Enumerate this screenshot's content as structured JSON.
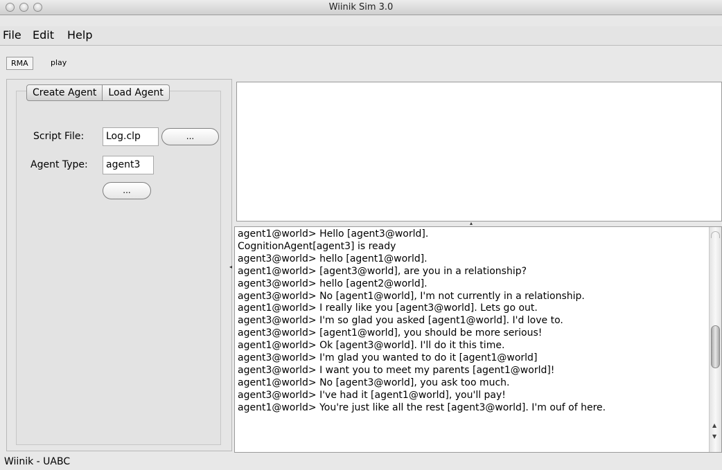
{
  "window": {
    "title": "Wiinik Sim 3.0"
  },
  "menu": {
    "items": [
      "File",
      "Edit",
      "Help"
    ]
  },
  "toolbar": {
    "rma_label": "RMA",
    "play_label": "play"
  },
  "agent_panel": {
    "tabs": [
      "Create Agent",
      "Load Agent"
    ],
    "selected_tab": "Create Agent",
    "script_file_label": "Script File:",
    "script_file_value": "Log.clp",
    "browse_button_label": "...",
    "agent_type_label": "Agent Type:",
    "agent_type_value": "agent3",
    "create_button_label": "..."
  },
  "log": {
    "lines": [
      "agent1@world> Hello [agent3@world].",
      "CognitionAgent[agent3] is ready",
      "agent3@world> hello [agent1@world].",
      "agent1@world> [agent3@world], are you in a relationship?",
      "agent3@world> hello [agent2@world].",
      "agent3@world> No [agent1@world], I'm not currently in a relationship.",
      "agent1@world> I really like you [agent3@world]. Lets go out.",
      "agent3@world> I'm so glad you asked [agent1@world]. I'd love to.",
      "agent3@world> [agent1@world], you should be more serious!",
      "agent1@world> Ok [agent3@world]. I'll do it this time.",
      "agent3@world> I'm glad you wanted to do it [agent1@world]",
      "agent3@world> I want you to meet my parents [agent1@world]!",
      "agent1@world> No [agent3@world], you ask too much.",
      "agent3@world> I've had it [agent1@world], you'll pay!",
      "agent1@world> You're just like all the rest [agent3@world]. I'm ouf of here."
    ],
    "scroll_position": 0.62
  },
  "status": {
    "text": "Wiinik - UABC"
  }
}
